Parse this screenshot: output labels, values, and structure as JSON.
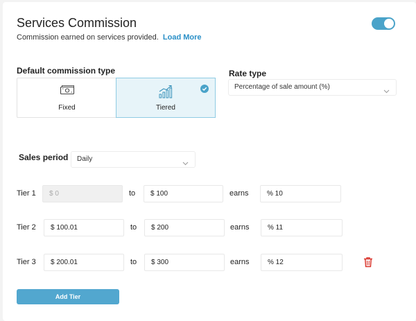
{
  "header": {
    "title": "Services Commission",
    "subtitle": "Commission earned on services provided.",
    "link": "Load More",
    "toggle_on": true
  },
  "commission_type": {
    "label": "Default commission type",
    "options": [
      {
        "label": "Fixed",
        "icon": "cash-icon",
        "selected": false
      },
      {
        "label": "Tiered",
        "icon": "chart-growth-icon",
        "selected": true
      }
    ]
  },
  "rate_type": {
    "label": "Rate type",
    "value": "Percentage of sale amount (%)"
  },
  "sales_period": {
    "label": "Sales period",
    "value": "Daily"
  },
  "tiers": [
    {
      "label": "Tier 1",
      "from": "$ 0",
      "from_disabled": true,
      "to_word": "to",
      "to": "$ 100",
      "earns_word": "earns",
      "earns": "% 10"
    },
    {
      "label": "Tier 2",
      "from": "$ 100.01",
      "from_disabled": false,
      "to_word": "to",
      "to": "$ 200",
      "earns_word": "earns",
      "earns": "% 11"
    },
    {
      "label": "Tier 3",
      "from": "$ 200.01",
      "from_disabled": false,
      "to_word": "to",
      "to": "$ 300",
      "earns_word": "earns",
      "earns": "% 12",
      "deletable": true
    }
  ],
  "add_tier": "Add Tier",
  "colors": {
    "accent": "#4aa3c9",
    "delete": "#d9342b"
  }
}
